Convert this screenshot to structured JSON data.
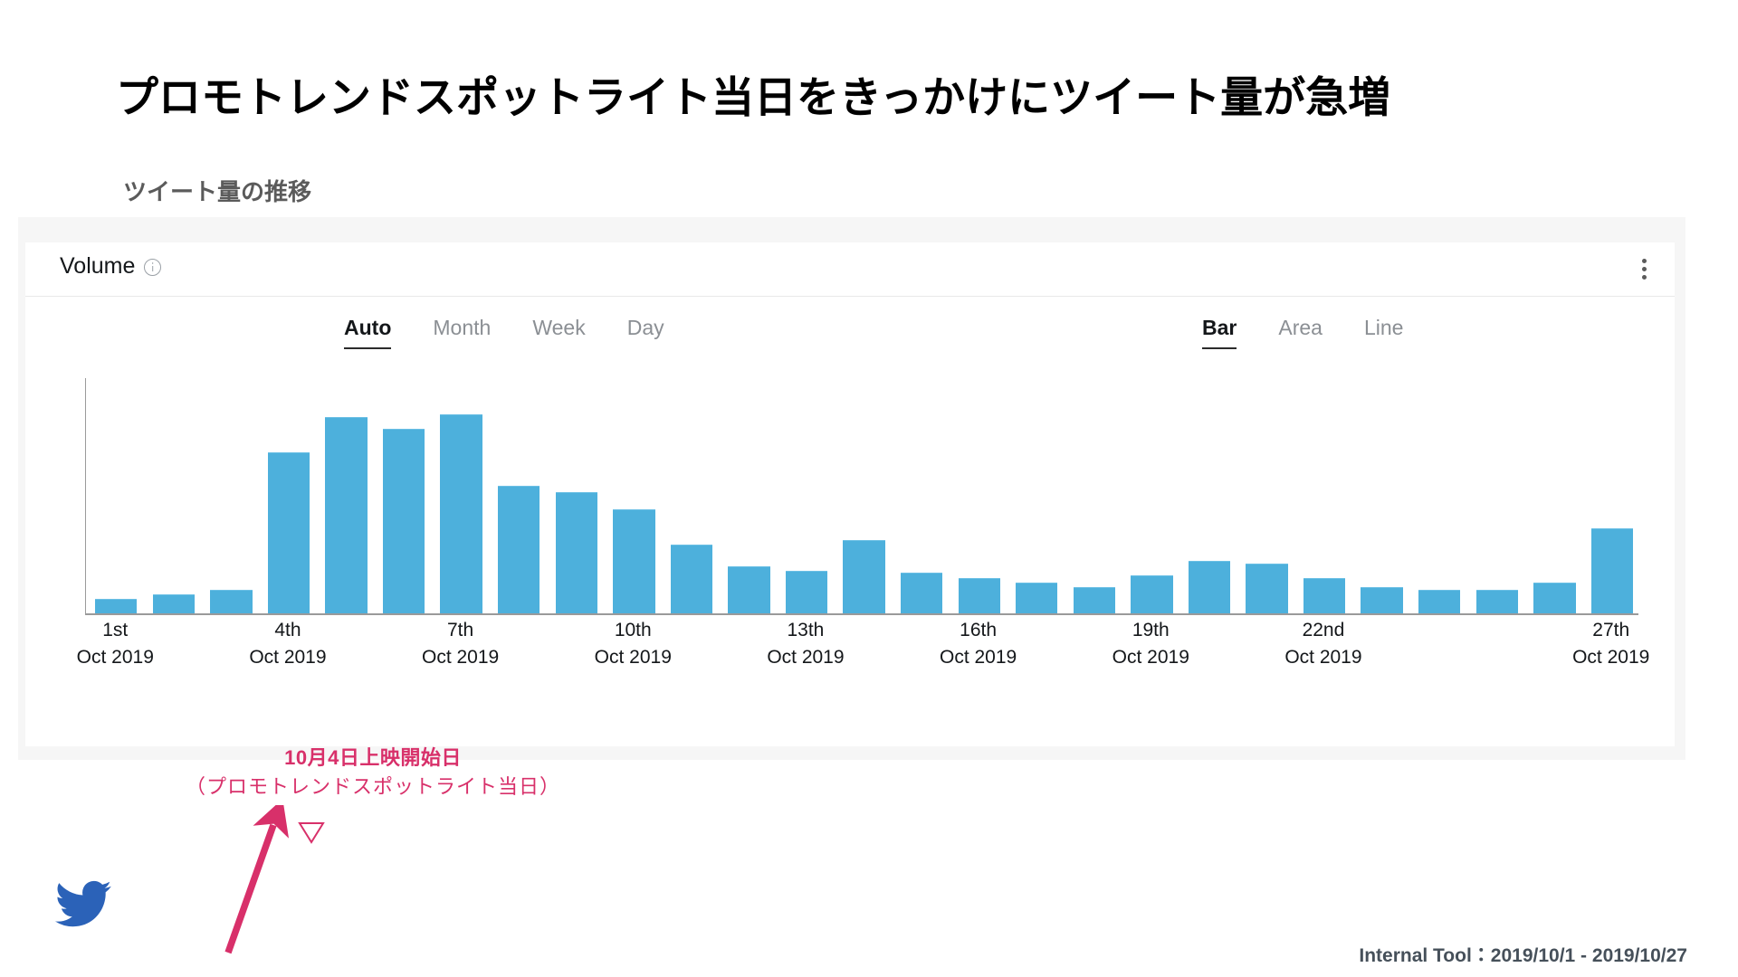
{
  "slide": {
    "title": "プロモトレンドスポットライト当日をきっかけにツイート量が急増",
    "subtitle": "ツイート量の推移",
    "footer_note": "Internal Tool：2019/10/1 - 2019/10/27",
    "logo_name": "twitter-bird-logo"
  },
  "card": {
    "title": "Volume",
    "info_icon": "info-circle-icon",
    "menu_icon": "kebab-menu-icon"
  },
  "interval_tabs": [
    {
      "label": "Auto",
      "active": true
    },
    {
      "label": "Month",
      "active": false
    },
    {
      "label": "Week",
      "active": false
    },
    {
      "label": "Day",
      "active": false
    }
  ],
  "charttype_tabs": [
    {
      "label": "Bar",
      "active": true
    },
    {
      "label": "Area",
      "active": false
    },
    {
      "label": "Line",
      "active": false
    }
  ],
  "annotation": {
    "line1": "10月4日上映開始日",
    "line2": "（プロモトレンドスポットライト当日）",
    "color": "#d8306a",
    "marker_icon": "down-triangle-marker-icon",
    "arrow_icon": "up-arrow-annotation-icon",
    "points_to": "4th Oct 2019"
  },
  "colors": {
    "bar": "#4db0dc",
    "bar_top": "#6cc0e5",
    "accent_red": "#d8306a",
    "twitter_blue": "#2b62b8",
    "axis": "#9a9a9a",
    "card_bg": "#ffffff",
    "frame_bg": "#f6f6f6",
    "tab_active": "#14171a",
    "tab_inactive": "#8b8f94"
  },
  "chart_data": {
    "type": "bar",
    "title": "Volume",
    "xlabel": "",
    "ylabel": "",
    "grid": false,
    "legend": "none",
    "axis_ticks_shown": [
      "1st",
      "4th",
      "7th",
      "10th",
      "13th",
      "16th",
      "19th",
      "22nd",
      "27th"
    ],
    "tick_sublabel": "Oct 2019",
    "date_range": "2019/10/1 - 2019/10/27",
    "categories": [
      "1st Oct 2019",
      "2nd Oct 2019",
      "3rd Oct 2019",
      "4th Oct 2019",
      "5th Oct 2019",
      "6th Oct 2019",
      "7th Oct 2019",
      "8th Oct 2019",
      "9th Oct 2019",
      "10th Oct 2019",
      "11th Oct 2019",
      "12th Oct 2019",
      "13th Oct 2019",
      "14th Oct 2019",
      "15th Oct 2019",
      "16th Oct 2019",
      "17th Oct 2019",
      "18th Oct 2019",
      "19th Oct 2019",
      "20th Oct 2019",
      "21st Oct 2019",
      "22nd Oct 2019",
      "23rd Oct 2019",
      "24th Oct 2019",
      "25th Oct 2019",
      "26th Oct 2019",
      "27th Oct 2019"
    ],
    "values": [
      6,
      8,
      10,
      68,
      83,
      78,
      84,
      54,
      51,
      44,
      29,
      20,
      18,
      31,
      17,
      15,
      13,
      11,
      16,
      22,
      21,
      15,
      11,
      10,
      10,
      13,
      36
    ],
    "ylim": [
      0,
      100
    ],
    "value_units": "relative tweet volume (unlabeled axis)"
  },
  "xticks": [
    {
      "day": "1st",
      "mon": "Oct 2019",
      "index": 0
    },
    {
      "day": "4th",
      "mon": "Oct 2019",
      "index": 3
    },
    {
      "day": "7th",
      "mon": "Oct 2019",
      "index": 6
    },
    {
      "day": "10th",
      "mon": "Oct 2019",
      "index": 9
    },
    {
      "day": "13th",
      "mon": "Oct 2019",
      "index": 12
    },
    {
      "day": "16th",
      "mon": "Oct 2019",
      "index": 15
    },
    {
      "day": "19th",
      "mon": "Oct 2019",
      "index": 18
    },
    {
      "day": "22nd",
      "mon": "Oct 2019",
      "index": 21
    },
    {
      "day": "27th",
      "mon": "Oct 2019",
      "index": 26
    }
  ]
}
